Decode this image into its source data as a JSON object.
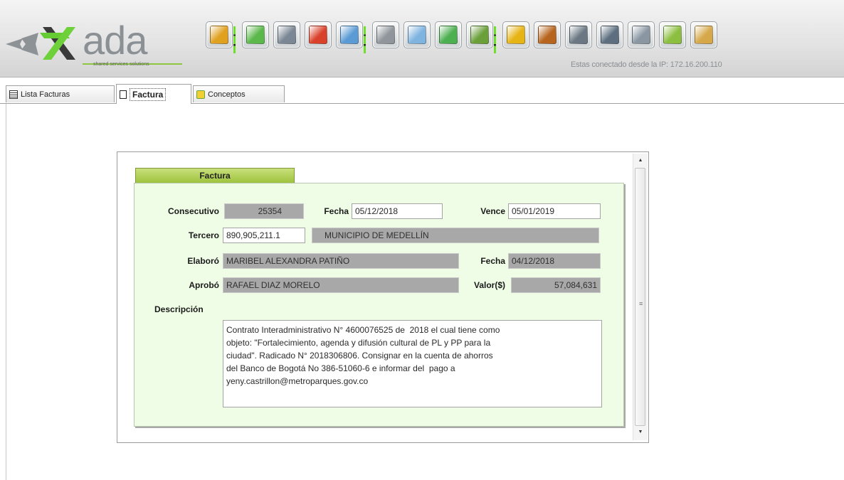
{
  "header": {
    "logo_text": "ada",
    "logo_tagline": "shared services solutions",
    "ip_status": "Estas conectado desde la IP: 172.16.200.110",
    "toolbar_icons": [
      {
        "name": "open-folder-icon",
        "color": "#e0a020"
      },
      {
        "name": "new-document-icon",
        "color": "#5bb84a"
      },
      {
        "name": "save-icon",
        "color": "#7b8794"
      },
      {
        "name": "delete-icon",
        "color": "#d9412b"
      },
      {
        "name": "undo-icon",
        "color": "#5b9bd5"
      },
      {
        "name": "print-icon",
        "color": "#8f959b"
      },
      {
        "name": "preview-icon",
        "color": "#7fb3e0"
      },
      {
        "name": "export-icon",
        "color": "#4caf50"
      },
      {
        "name": "import-icon",
        "color": "#6a9f3a"
      },
      {
        "name": "lock-icon",
        "color": "#e7b416"
      },
      {
        "name": "money-bag-icon",
        "color": "#b7651e"
      },
      {
        "name": "camera-icon",
        "color": "#6b7883"
      },
      {
        "name": "grid-icon",
        "color": "#5c6e7f"
      },
      {
        "name": "cart-icon",
        "color": "#8a97a3"
      },
      {
        "name": "settings-icon",
        "color": "#8cbf3f"
      },
      {
        "name": "users-icon",
        "color": "#d6a84a"
      }
    ]
  },
  "tabs": [
    {
      "label": "Lista Facturas"
    },
    {
      "label": "Factura"
    },
    {
      "label": "Conceptos"
    }
  ],
  "form": {
    "section_title": "Factura",
    "consecutivo_label": "Consecutivo",
    "consecutivo_value": "25354",
    "fecha_label": "Fecha",
    "fecha_value": "05/12/2018",
    "vence_label": "Vence",
    "vence_value": "05/01/2019",
    "tercero_label": "Tercero",
    "tercero_id": "890,905,211.1",
    "tercero_name": "MUNICIPIO DE MEDELLÍN",
    "elaboro_label": "Elaboró",
    "elaboro_value": "MARIBEL ALEXANDRA PATIÑO",
    "fecha_elab_label": "Fecha",
    "fecha_elab_value": "04/12/2018",
    "aprobo_label": "Aprobó",
    "aprobo_value": "RAFAEL DIAZ  MORELO",
    "valor_label": "Valor($)",
    "valor_value": "57,084,631",
    "descripcion_label": "Descripción",
    "descripcion_value": "Contrato Interadministrativo N° 4600076525 de  2018 el cual tiene como\nobjeto: \"Fortalecimiento, agenda y difusión cultural de PL y PP para la\nciudad\". Radicado N° 2018306806. Consignar en la cuenta de ahorros\ndel Banco de Bogotá No 386-51060-6 e informar del  pago a\nyeny.castrillon@metroparques.gov.co"
  },
  "colors": {
    "accent_green": "#8dc63f",
    "form_bg": "#effde6",
    "readonly_bg": "#a8a8a8"
  }
}
